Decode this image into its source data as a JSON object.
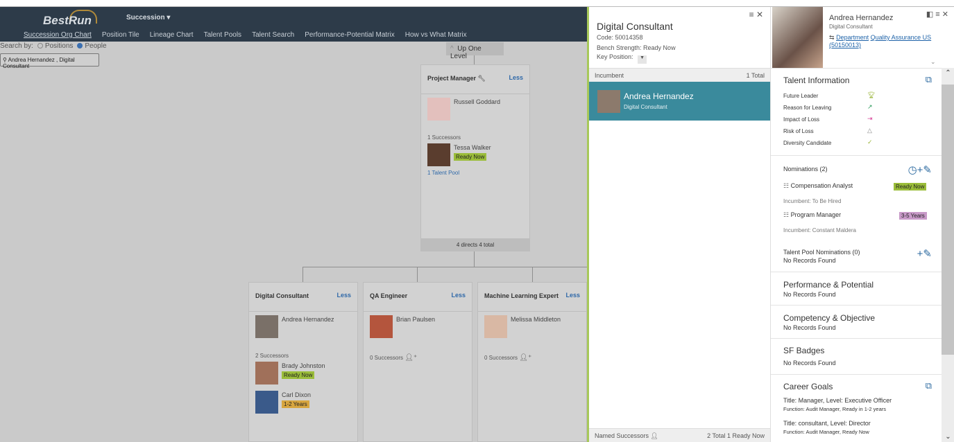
{
  "app": {
    "logo": "BestRun",
    "module": "Succession"
  },
  "nav": [
    "Succession Org Chart",
    "Position Tile",
    "Lineage Chart",
    "Talent Pools",
    "Talent Search",
    "Performance-Potential Matrix",
    "How vs What Matrix"
  ],
  "search": {
    "label": "Search by:",
    "opt_positions": "Positions",
    "opt_people": "People",
    "selected": "People",
    "value": "Andrea Hernandez , Digital Consultant"
  },
  "org": {
    "up_one_level": "Up One Level",
    "top": {
      "title": "Project Manager",
      "less": "Less",
      "incumbent": "Russell Goddard",
      "successors_label": "1 Successors",
      "successors": [
        {
          "name": "Tessa Walker",
          "readiness": "Ready Now"
        }
      ],
      "talent_pool": "1 Talent Pool",
      "footer": "4 directs 4 total"
    },
    "children": [
      {
        "title": "Digital Consultant",
        "less": "Less",
        "incumbent": "Andrea Hernandez",
        "successors_label": "2 Successors",
        "successors": [
          {
            "name": "Brady Johnston",
            "readiness": "Ready Now"
          },
          {
            "name": "Carl Dixon",
            "readiness": "1-2 Years"
          }
        ]
      },
      {
        "title": "QA Engineer",
        "less": "Less",
        "incumbent": "Brian Paulsen",
        "successors_label": "0 Successors"
      },
      {
        "title": "Machine Learning Expert",
        "less": "Less",
        "incumbent": "Melissa Middleton",
        "successors_label": "0 Successors"
      }
    ]
  },
  "position_panel": {
    "title": "Digital Consultant",
    "code": "Code: 50014358",
    "bench": "Bench Strength: Ready Now",
    "key_position": "Key Position:",
    "incumbent_label": "Incumbent",
    "incumbent_total": "1 Total",
    "incumbent": {
      "name": "Andrea Hernandez",
      "title": "Digital Consultant"
    },
    "footer_label": "Named Successors",
    "footer_total": "2 Total 1 Ready Now",
    "accent": "#3a8a9c"
  },
  "person_panel": {
    "name": "Andrea Hernandez",
    "title": "Digital Consultant",
    "dept_label": "Department",
    "dept_value": "Quality Assurance US",
    "dept_code": "(50150013)",
    "talent": {
      "title": "Talent Information",
      "items": [
        {
          "label": "Future Leader",
          "icon": "trophy"
        },
        {
          "label": "Reason for Leaving",
          "icon": "chart"
        },
        {
          "label": "Impact of Loss",
          "icon": "exit"
        },
        {
          "label": "Risk of Loss",
          "icon": "triangle"
        },
        {
          "label": "Diversity Candidate",
          "icon": "handshake"
        }
      ]
    },
    "nominations": {
      "title": "Nominations (2)",
      "items": [
        {
          "position": "Compensation Analyst",
          "readiness": "Ready Now",
          "incumbent": "Incumbent: To Be Hired"
        },
        {
          "position": "Program Manager",
          "readiness": "3-5 Years",
          "incumbent": "Incumbent: Constant Maldera"
        }
      ]
    },
    "pool": {
      "title": "Talent Pool Nominations (0)",
      "empty": "No Records Found"
    },
    "perf": {
      "title": "Performance & Potential",
      "empty": "No Records Found"
    },
    "comp": {
      "title": "Competency & Objective",
      "empty": "No Records Found"
    },
    "badges": {
      "title": "SF Badges",
      "empty": "No Records Found"
    },
    "goals": {
      "title": "Career Goals",
      "items": [
        {
          "title": "Title: Manager, Level: Executive Officer",
          "detail": "Function: Audit Manager, Ready in 1-2 years"
        },
        {
          "title": "Title: consultant, Level: Director",
          "detail": "Function: Audit Manager, Ready Now"
        }
      ]
    }
  }
}
